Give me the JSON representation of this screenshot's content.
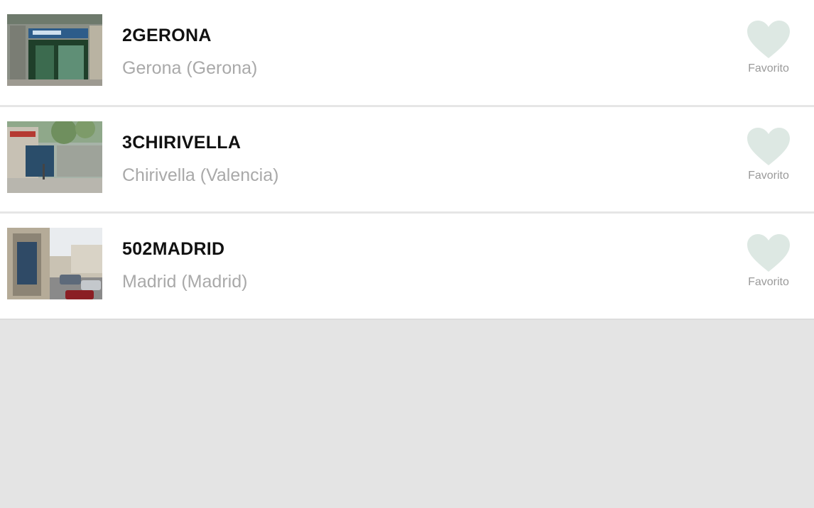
{
  "colors": {
    "heart": "#dde8e3",
    "title": "#111111",
    "subtitle": "#a9a9a9",
    "background": "#e4e4e4"
  },
  "stores": [
    {
      "name": "2GERONA",
      "location": "Gerona (Gerona)",
      "favorite_label": "Favorito",
      "thumbnail_icon": "storefront-photo"
    },
    {
      "name": "3CHIRIVELLA",
      "location": "Chirivella (Valencia)",
      "favorite_label": "Favorito",
      "thumbnail_icon": "storefront-photo"
    },
    {
      "name": "502MADRID",
      "location": "Madrid (Madrid)",
      "favorite_label": "Favorito",
      "thumbnail_icon": "street-photo"
    }
  ]
}
